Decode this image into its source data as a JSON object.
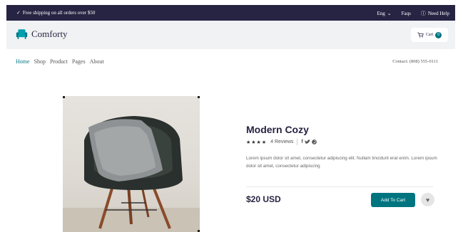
{
  "topbar": {
    "promo_icon": "check-icon",
    "promo_text": "Free shipping on all orders over $50",
    "language": "Eng",
    "faqs": "Faqs",
    "help": "Need Help"
  },
  "header": {
    "brand": "Comforty",
    "cart_label": "Cart",
    "cart_count": "0"
  },
  "nav": {
    "items": [
      "Home",
      "Shop",
      "Product",
      "Pages",
      "About"
    ],
    "contact": "Contact: (808) 555-0111"
  },
  "product": {
    "title": "Modern Cozy",
    "stars": "★★★★",
    "reviews": "4 Reviews",
    "description": "Lorem ipsum dolor sit amet, consectetur adipiscing elit. Nullam tincidunt erat enim. Lorem ipsum dolor sit amet, consectetur adipiscing",
    "price": "$20 USD",
    "add_to_cart": "Add To Cart"
  },
  "colors": {
    "dark": "#272343",
    "accent": "#007580",
    "header_bg": "#f0f2f3"
  }
}
